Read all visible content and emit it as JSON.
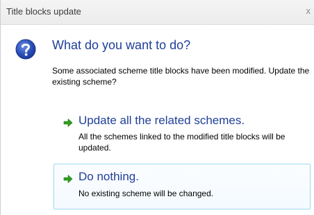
{
  "window": {
    "title": "Title blocks update",
    "close_label": "x"
  },
  "dialog": {
    "heading": "What do you want to do?",
    "message": "Some associated scheme title blocks have been modified. Update the existing scheme?",
    "icon": "question-icon",
    "options": [
      {
        "title": "Update all the related schemes.",
        "description": "All the schemes linked to the modified title blocks will be updated.",
        "icon": "green-arrow-icon"
      },
      {
        "title": "Do nothing.",
        "description": "No existing scheme will be changed.",
        "icon": "green-arrow-icon"
      }
    ]
  },
  "colors": {
    "accent_text": "#1f3f99",
    "arrow_green": "#2e9d20",
    "highlight_border": "#9fd8ec"
  }
}
